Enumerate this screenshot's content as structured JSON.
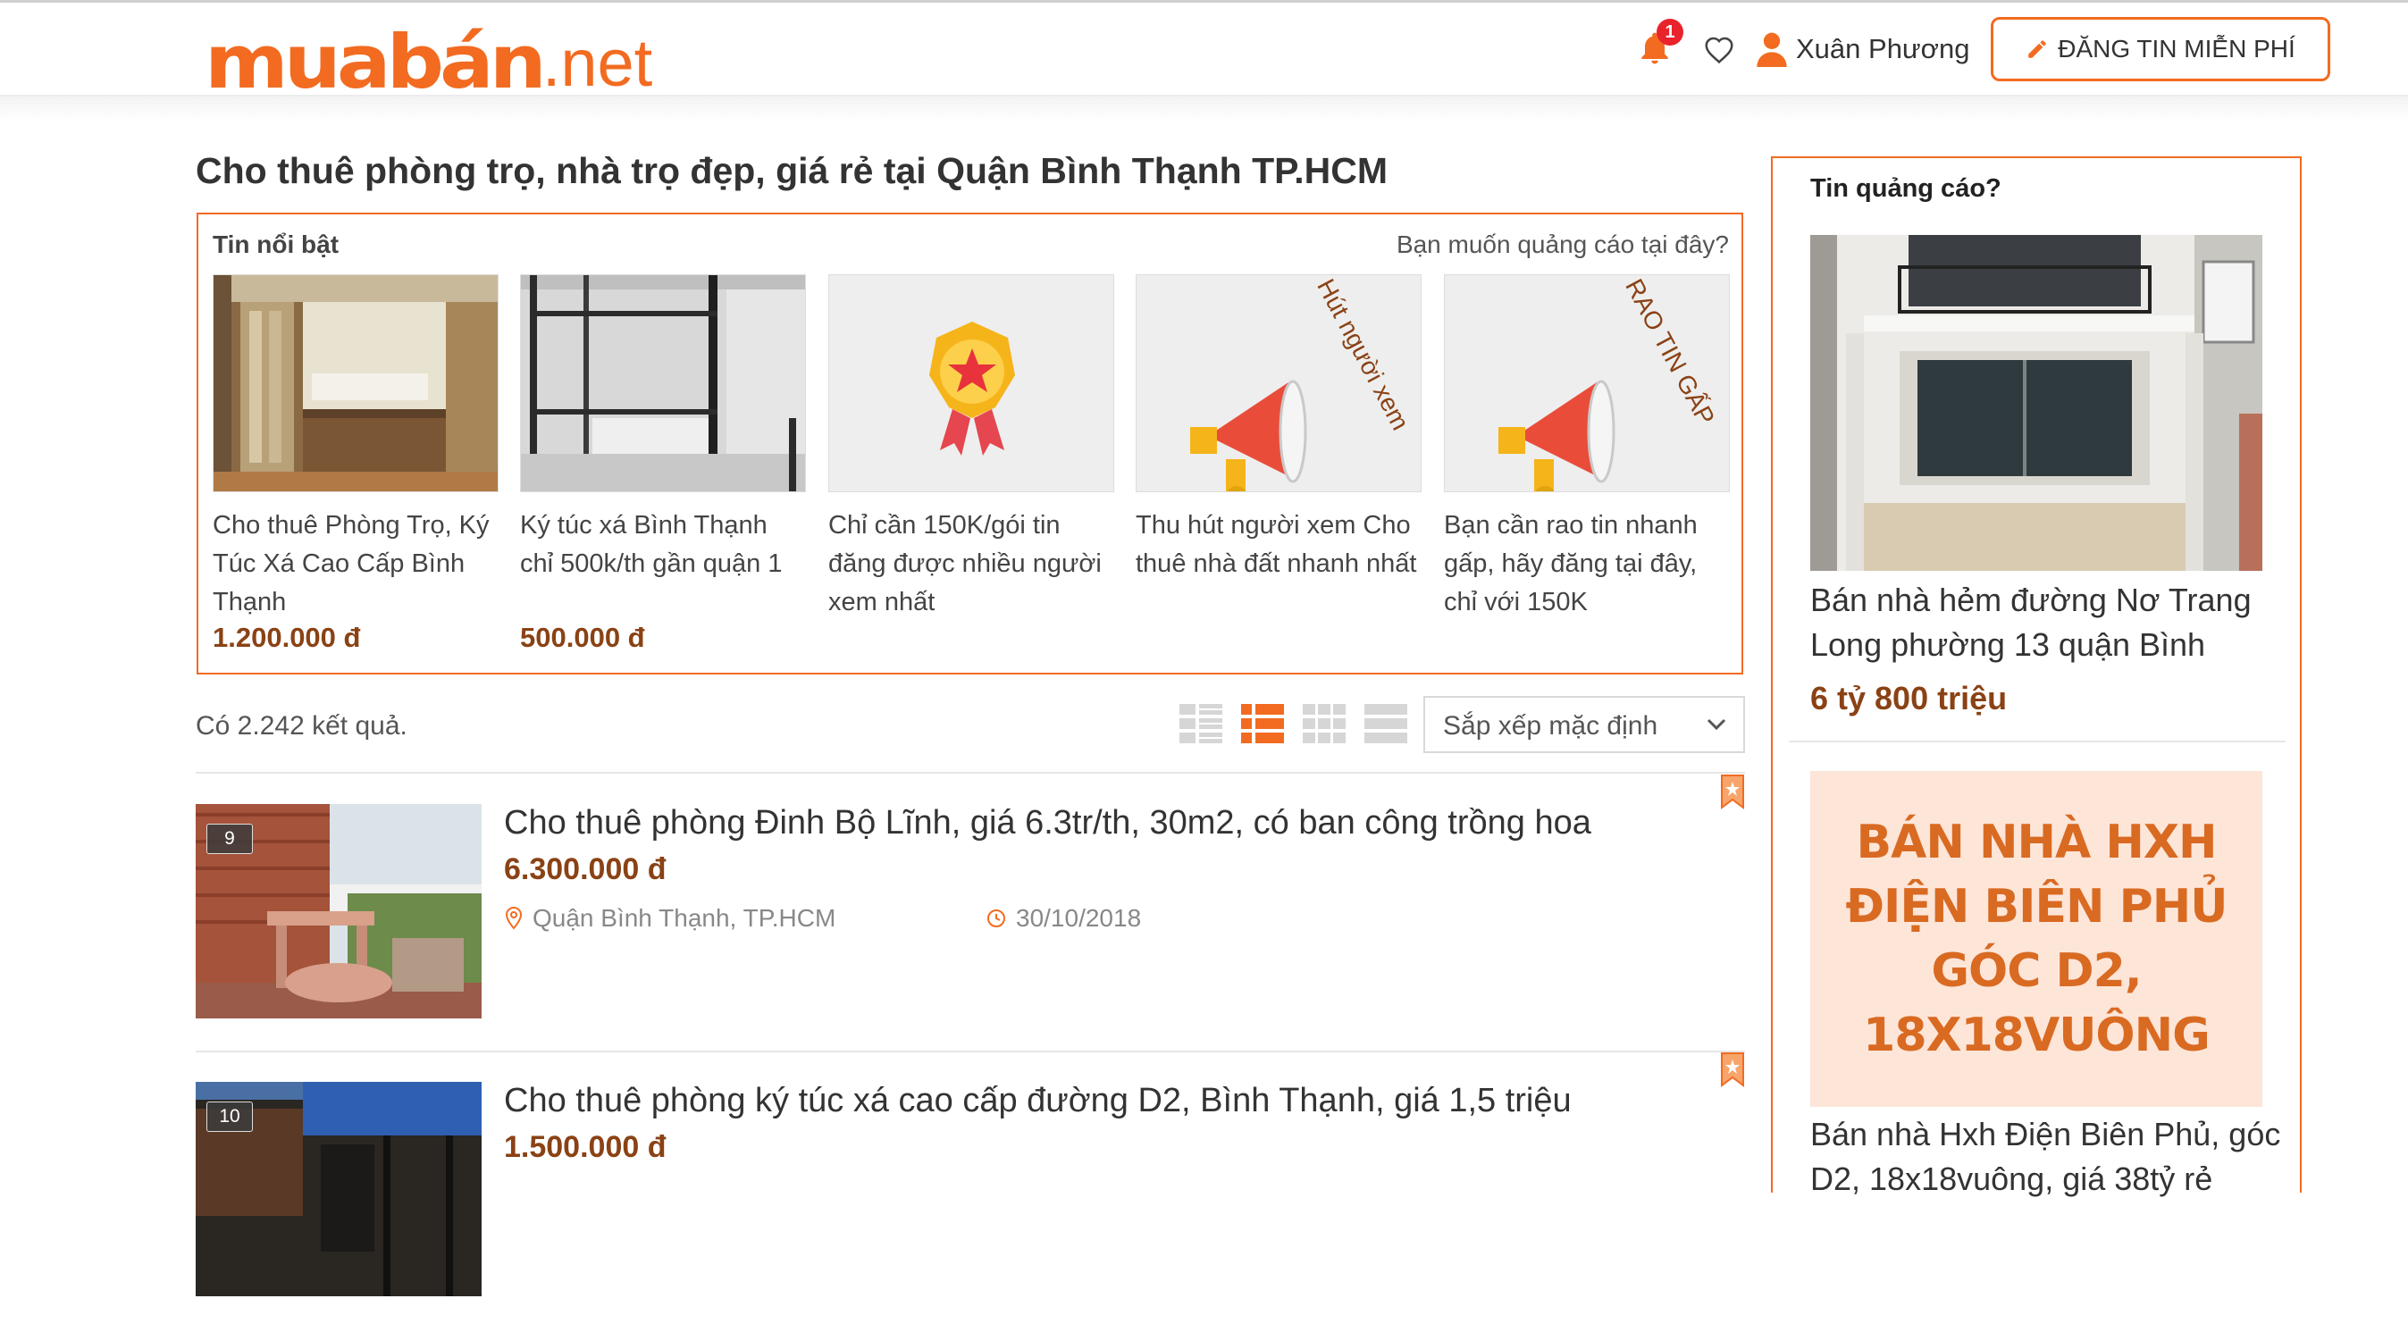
{
  "header": {
    "logo_main": "muabán",
    "logo_tld": ".net",
    "notification_count": "1",
    "user_name": "Xuân Phương",
    "post_button_label": "ĐĂNG TIN MIỄN PHÍ"
  },
  "page_title": "Cho thuê phòng trọ, nhà trọ đẹp, giá rẻ tại Quận Bình Thạnh TP.HCM",
  "featured": {
    "label": "Tin nổi bật",
    "ad_link": "Bạn muốn quảng cáo tại đây?",
    "items": [
      {
        "title": "Cho thuê Phòng Trọ, Ký Túc Xá Cao Cấp Bình Thạnh",
        "price": "1.200.000 đ",
        "image": "dorm-bunk-beds-photo"
      },
      {
        "title": "Ký túc xá Bình Thạnh chỉ 500k/th gần quận 1",
        "price": "500.000 đ",
        "image": "metal-bunk-beds-photo"
      },
      {
        "title": "Chỉ cần 150K/gói tin đăng được nhiều người xem nhất",
        "price": "",
        "image": "star-medal-icon"
      },
      {
        "title": "Thu hút người xem Cho thuê nhà đất nhanh nhất",
        "price": "",
        "image": "megaphone-icon",
        "image_text": "Hút người xem"
      },
      {
        "title": "Bạn cần rao tin nhanh gấp, hãy đăng tại đây, chỉ với 150K",
        "price": "",
        "image": "megaphone-icon",
        "image_text": "RAO TIN GẤP"
      }
    ]
  },
  "results": {
    "count_text": "Có 2.242 kết quả.",
    "view_modes": [
      "detail-view-icon",
      "list-view-icon",
      "grid-view-icon",
      "compact-view-icon"
    ],
    "active_view": "list-view-icon",
    "sort_label": "Sắp xếp mặc định"
  },
  "listings": [
    {
      "title": "Cho thuê phòng Đinh Bộ Lĩnh, giá 6.3tr/th, 30m2, có ban công trồng hoa",
      "price": "6.300.000 đ",
      "location": "Quận Bình Thạnh, TP.HCM",
      "date": "30/10/2018",
      "photo_count": "9"
    },
    {
      "title": "Cho thuê phòng ký túc xá cao cấp đường D2, Bình Thạnh, giá 1,5 triệu",
      "price": "1.500.000 đ",
      "location": "",
      "date": "",
      "photo_count": "10"
    }
  ],
  "sidebar": {
    "heading": "Tin quảng cáo?",
    "ads": [
      {
        "title": "Bán nhà hẻm đường Nơ Trang Long phường 13 quận Bình",
        "price": "6 tỷ 800 triệu"
      },
      {
        "banner_text": "BÁN NHÀ HXH ĐIỆN BIÊN PHỦ GÓC D2, 18X18VUÔNG",
        "title": "Bán nhà Hxh Điện Biên Phủ, góc D2, 18x18vuông, giá 38tỷ rẻ"
      }
    ]
  },
  "colors": {
    "brand": "#f26b21",
    "price": "#8a4215",
    "badge": "#e8232b"
  }
}
